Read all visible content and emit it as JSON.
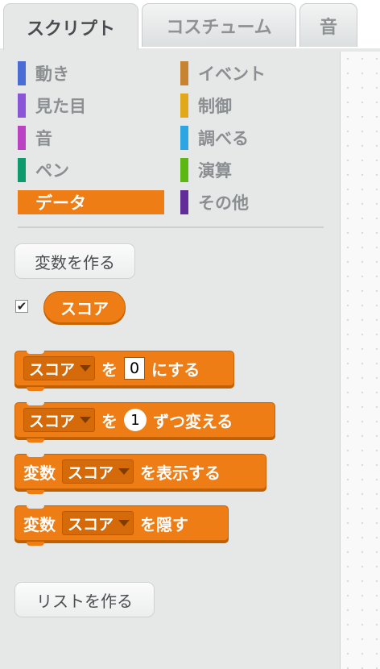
{
  "tabs": [
    {
      "label": "スクリプト",
      "active": true
    },
    {
      "label": "コスチューム",
      "active": false
    },
    {
      "label": "音",
      "active": false
    }
  ],
  "categories": [
    {
      "label": "動き",
      "color": "#4a6cd4"
    },
    {
      "label": "見た目",
      "color": "#8a55d7"
    },
    {
      "label": "音",
      "color": "#bb42c3"
    },
    {
      "label": "ペン",
      "color": "#0e9a6c"
    },
    {
      "label": "データ",
      "color": "#ee7d16",
      "selected": true
    },
    {
      "label": "イベント",
      "color": "#c88330"
    },
    {
      "label": "制御",
      "color": "#e1a91a"
    },
    {
      "label": "調べる",
      "color": "#2ca5e2"
    },
    {
      "label": "演算",
      "color": "#5cb712"
    },
    {
      "label": "その他",
      "color": "#632d99"
    }
  ],
  "make_variable_label": "変数を作る",
  "variable": {
    "name": "スコア",
    "checked": true,
    "checkmark": "✔"
  },
  "blocks": {
    "set": {
      "var": "スコア",
      "word1": "を",
      "value": "0",
      "word2": "にする"
    },
    "change": {
      "var": "スコア",
      "word1": "を",
      "value": "1",
      "word2": "ずつ変える"
    },
    "show": {
      "prefix": "変数",
      "var": "スコア",
      "suffix": "を表示する"
    },
    "hide": {
      "prefix": "変数",
      "var": "スコア",
      "suffix": "を隠す"
    }
  },
  "make_list_label": "リストを作る",
  "colors": {
    "data_orange": "#ee7d16",
    "palette_bg": "#e6e8e8"
  }
}
